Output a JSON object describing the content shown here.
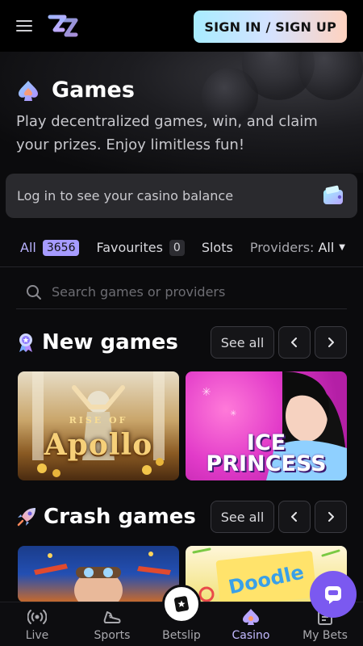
{
  "header": {
    "signin_label": "SIGN IN / SIGN UP"
  },
  "hero": {
    "title": "Games",
    "subtitle": "Play decentralized games, win, and claim your prizes. Enjoy limitless fun!"
  },
  "balance": {
    "text": "Log in to see your casino balance"
  },
  "tabs": {
    "all_label": "All",
    "all_count": "3656",
    "favourites_label": "Favourites",
    "favourites_count": "0",
    "slots_label": "Slots",
    "providers_label": "Providers:",
    "providers_value": "All"
  },
  "search": {
    "placeholder": "Search games or providers"
  },
  "sections": {
    "new_games": {
      "title": "New games",
      "see_all": "See all"
    },
    "crash_games": {
      "title": "Crash games",
      "see_all": "See all"
    }
  },
  "games": {
    "apollo_small": "RISE OF",
    "apollo_title": "Apollo",
    "ice_title": "ICE PRINCESS",
    "doodle_title": "Doodle"
  },
  "bottom_nav": {
    "live": "Live",
    "sports": "Sports",
    "betslip": "Betslip",
    "casino": "Casino",
    "mybets": "My Bets"
  },
  "colors": {
    "accent": "#a69bff",
    "active_nav": "#c2b9ff",
    "chat_fab": "#7b59f0"
  }
}
